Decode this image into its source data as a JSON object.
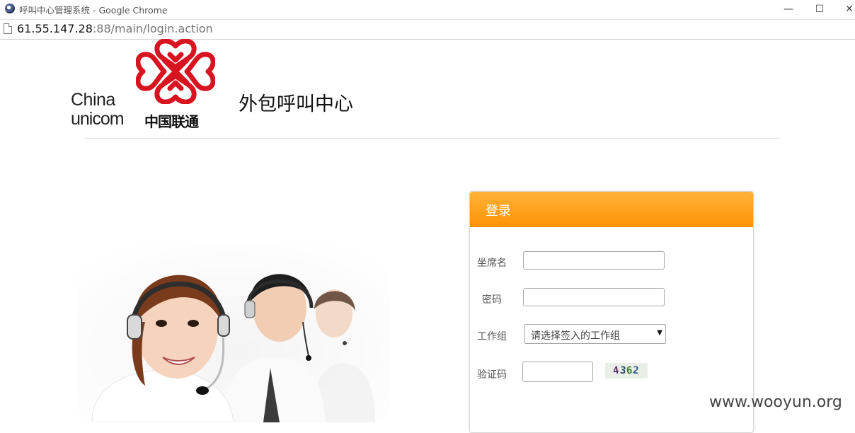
{
  "window": {
    "title": "呼叫中心管理系统 - Google Chrome",
    "minimize_glyph": "—",
    "maximize_glyph": "☐",
    "close_glyph": "✕"
  },
  "address_bar": {
    "host": "61.55.147.28",
    "rest": ":88/main/login.action"
  },
  "logo": {
    "china": "China",
    "unicom": "unicom",
    "chinese": "中国联通"
  },
  "site_title": "外包呼叫中心",
  "login": {
    "title": "登录",
    "agent_label": "坐席名",
    "agent_value": "",
    "password_label": "密码",
    "password_value": "",
    "workgroup_label": "工作组",
    "workgroup_selected": "请选择签入的工作组",
    "captcha_label": "验证码",
    "captcha_value": "",
    "captcha_text": "4362"
  },
  "colors": {
    "header_orange_top": "#ffb239",
    "header_orange_bottom": "#ff9406",
    "logo_red": "#d7141f"
  },
  "watermark": "www.wooyun.org"
}
